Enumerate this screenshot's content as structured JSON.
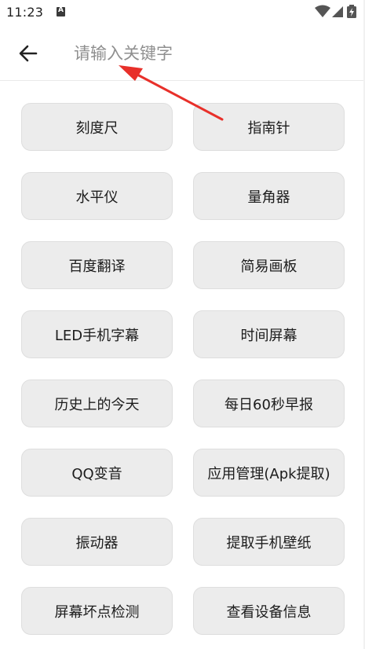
{
  "status_bar": {
    "time": "11:23",
    "icons": [
      "notification-a-icon",
      "wifi-icon",
      "signal-icon",
      "battery-icon"
    ]
  },
  "search": {
    "placeholder": "请输入关键字",
    "value": ""
  },
  "tools": [
    "刻度尺",
    "指南针",
    "水平仪",
    "量角器",
    "百度翻译",
    "简易画板",
    "LED手机字幕",
    "时间屏幕",
    "历史上的今天",
    "每日60秒早报",
    "QQ变音",
    "应用管理(Apk提取)",
    "振动器",
    "提取手机壁纸",
    "屏幕坏点检测",
    "查看设备信息"
  ],
  "colors": {
    "button_bg": "#ececec",
    "annotation_arrow": "#e8302a"
  }
}
